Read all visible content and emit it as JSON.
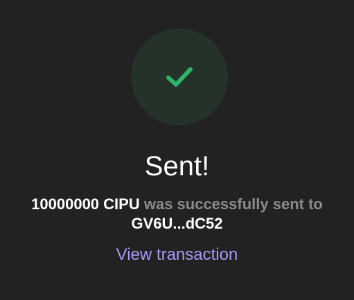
{
  "status": {
    "title": "Sent!",
    "amount": "10000000 CIPU",
    "message": "was successfully sent to",
    "address": "GV6U...dC52",
    "link_label": "View transaction"
  },
  "icons": {
    "success": "check-icon"
  },
  "colors": {
    "background": "#222222",
    "badge": "#243229",
    "check": "#2FB36A",
    "link": "#A79AF6",
    "muted_text": "#8A8A8A",
    "text": "#FFFFFF"
  }
}
